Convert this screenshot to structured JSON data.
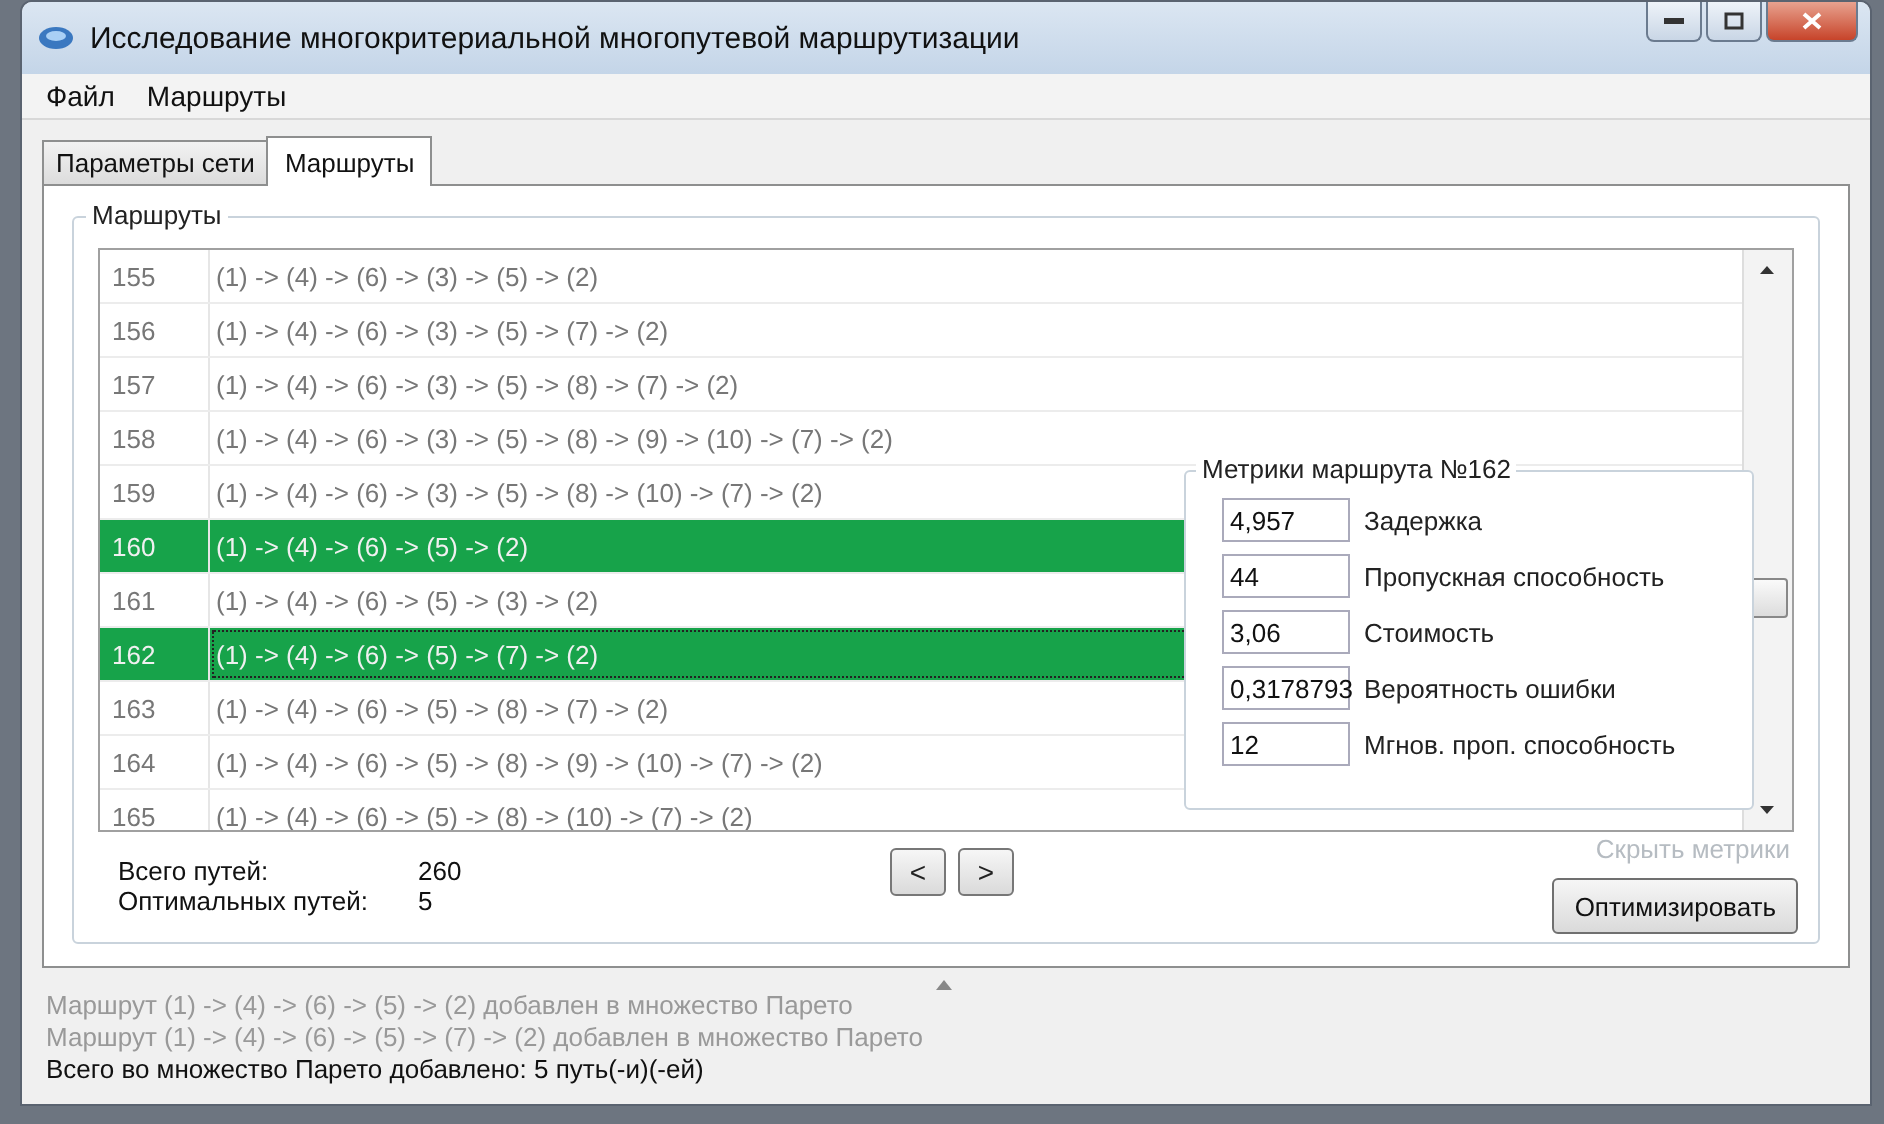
{
  "window": {
    "title": "Исследование многокритериальной многопутевой маршрутизации"
  },
  "menu": [
    "Файл",
    "Маршруты"
  ],
  "tabs": [
    {
      "label": "Параметры сети",
      "selected": false
    },
    {
      "label": "Маршруты",
      "selected": true
    }
  ],
  "routes": {
    "title": "Маршруты",
    "rows": [
      {
        "number": "155",
        "path": "(1) -> (4) -> (6) -> (3) -> (5) -> (2)",
        "selected": false,
        "focused": false
      },
      {
        "number": "156",
        "path": "(1) -> (4) -> (6) -> (3) -> (5) -> (7) -> (2)",
        "selected": false,
        "focused": false
      },
      {
        "number": "157",
        "path": "(1) -> (4) -> (6) -> (3) -> (5) -> (8) -> (7) -> (2)",
        "selected": false,
        "focused": false
      },
      {
        "number": "158",
        "path": "(1) -> (4) -> (6) -> (3) -> (5) -> (8) -> (9) -> (10) -> (7) -> (2)",
        "selected": false,
        "focused": false
      },
      {
        "number": "159",
        "path": "(1) -> (4) -> (6) -> (3) -> (5) -> (8) -> (10) -> (7) -> (2)",
        "selected": false,
        "focused": false
      },
      {
        "number": "160",
        "path": "(1) -> (4) -> (6) -> (5) -> (2)",
        "selected": true,
        "focused": false
      },
      {
        "number": "161",
        "path": "(1) -> (4) -> (6) -> (5) -> (3) -> (2)",
        "selected": false,
        "focused": false
      },
      {
        "number": "162",
        "path": "(1) -> (4) -> (6) -> (5) -> (7) -> (2)",
        "selected": true,
        "focused": true
      },
      {
        "number": "163",
        "path": "(1) -> (4) -> (6) -> (5) -> (8) -> (7) -> (2)",
        "selected": false,
        "focused": false
      },
      {
        "number": "164",
        "path": "(1) -> (4) -> (6) -> (5) -> (8) -> (9) -> (10) -> (7) -> (2)",
        "selected": false,
        "focused": false
      },
      {
        "number": "165",
        "path": "(1) -> (4) -> (6) -> (5) -> (8) -> (10) -> (7) -> (2)",
        "selected": false,
        "focused": false
      }
    ],
    "stats": [
      {
        "label": "Всего путей:",
        "value": "260"
      },
      {
        "label": "Оптимальных путей:",
        "value": "5"
      }
    ],
    "nav_buttons": [
      "<",
      ">"
    ],
    "hide_metrics": "Скрыть метрики",
    "optimize_button": "Оптимизировать"
  },
  "metrics": {
    "title": "Метрики маршрута №162",
    "items": [
      {
        "value": "4,957",
        "label": "Задержка"
      },
      {
        "value": "44",
        "label": "Пропускная способность"
      },
      {
        "value": "3,06",
        "label": "Стоимость"
      },
      {
        "value": "0,3178793",
        "label": "Вероятность ошибки"
      },
      {
        "value": "12",
        "label": "Мгнов. проп. способность"
      }
    ]
  },
  "log": [
    {
      "text": "Маршрут (1) -> (4) -> (6) -> (5) -> (2) добавлен в множество Парето",
      "dimmed": true
    },
    {
      "text": "Маршрут (1) -> (4) -> (6) -> (5) -> (7) -> (2) добавлен в множество Парето",
      "dimmed": true
    },
    {
      "text": "Всего во множество Парето добавлено: 5 путь(-и)(-ей)",
      "dimmed": false
    }
  ]
}
